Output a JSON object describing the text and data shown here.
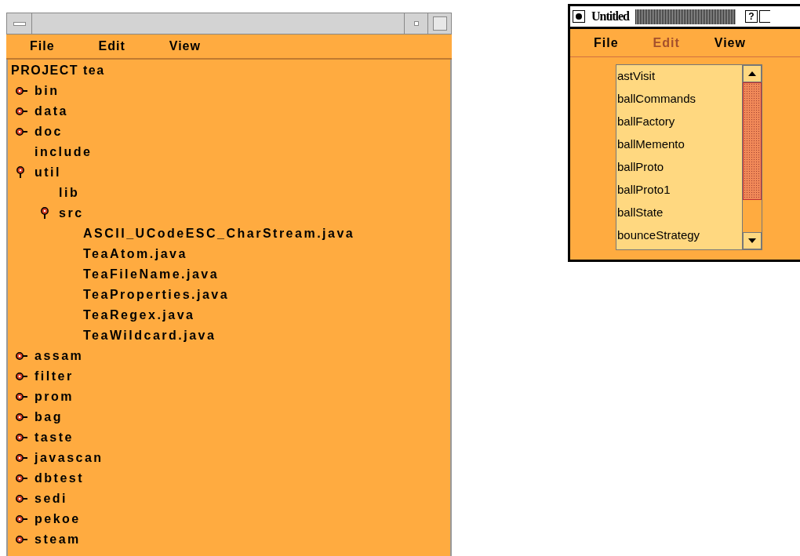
{
  "project_window": {
    "menu": [
      {
        "label": "File",
        "disabled": false
      },
      {
        "label": "Edit",
        "disabled": false
      },
      {
        "label": "View",
        "disabled": false
      }
    ],
    "tree": {
      "root": "PROJECT tea",
      "children": [
        {
          "label": "bin",
          "kind": "branch",
          "expanded": false
        },
        {
          "label": "data",
          "kind": "branch",
          "expanded": false
        },
        {
          "label": "doc",
          "kind": "branch",
          "expanded": false
        },
        {
          "label": "include",
          "kind": "leaf"
        },
        {
          "label": "util",
          "kind": "branch",
          "expanded": true,
          "children": [
            {
              "label": "lib",
              "kind": "leaf"
            },
            {
              "label": "src",
              "kind": "branch",
              "expanded": true,
              "children": [
                {
                  "label": "ASCII_UCodeESC_CharStream.java",
                  "kind": "leaf"
                },
                {
                  "label": "TeaAtom.java",
                  "kind": "leaf"
                },
                {
                  "label": "TeaFileName.java",
                  "kind": "leaf"
                },
                {
                  "label": "TeaProperties.java",
                  "kind": "leaf"
                },
                {
                  "label": "TeaRegex.java",
                  "kind": "leaf"
                },
                {
                  "label": "TeaWildcard.java",
                  "kind": "leaf"
                }
              ]
            }
          ]
        },
        {
          "label": "assam",
          "kind": "branch",
          "expanded": false
        },
        {
          "label": "filter",
          "kind": "branch",
          "expanded": false
        },
        {
          "label": "prom",
          "kind": "branch",
          "expanded": false
        },
        {
          "label": "bag",
          "kind": "branch",
          "expanded": false
        },
        {
          "label": "taste",
          "kind": "branch",
          "expanded": false
        },
        {
          "label": "javascan",
          "kind": "branch",
          "expanded": false
        },
        {
          "label": "dbtest",
          "kind": "branch",
          "expanded": false
        },
        {
          "label": "sedi",
          "kind": "branch",
          "expanded": false
        },
        {
          "label": "pekoe",
          "kind": "branch",
          "expanded": false
        },
        {
          "label": "steam",
          "kind": "branch",
          "expanded": false
        }
      ]
    }
  },
  "untitled_window": {
    "title": "Untitled",
    "help_button": "?",
    "menu": [
      {
        "label": "File",
        "disabled": false
      },
      {
        "label": "Edit",
        "disabled": true
      },
      {
        "label": "View",
        "disabled": false
      }
    ],
    "list": [
      {
        "label": "astVisit"
      },
      {
        "label": "ballCommands"
      },
      {
        "label": "ballFactory"
      },
      {
        "label": "ballMemento"
      },
      {
        "label": "ballProto"
      },
      {
        "label": "ballProto1"
      },
      {
        "label": "ballState"
      },
      {
        "label": "bounceStrategy"
      }
    ]
  }
}
